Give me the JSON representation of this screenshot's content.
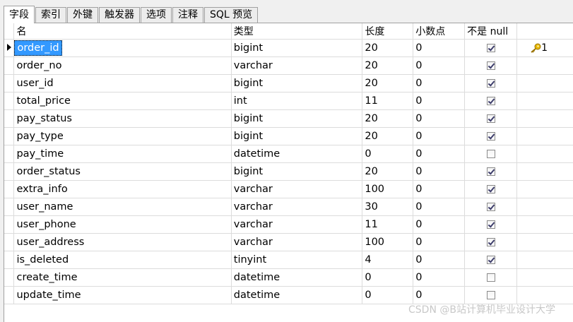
{
  "tabs": [
    "字段",
    "索引",
    "外键",
    "触发器",
    "选项",
    "注释",
    "SQL 预览"
  ],
  "columns": {
    "name": "名",
    "type": "类型",
    "length": "长度",
    "decimals": "小数点",
    "not_null": "不是 null",
    "key": ""
  },
  "rows": [
    {
      "name": "order_id",
      "type": "bigint",
      "length": "20",
      "decimals": "0",
      "not_null": true,
      "key": "1",
      "selected": true
    },
    {
      "name": "order_no",
      "type": "varchar",
      "length": "20",
      "decimals": "0",
      "not_null": true,
      "key": ""
    },
    {
      "name": "user_id",
      "type": "bigint",
      "length": "20",
      "decimals": "0",
      "not_null": true,
      "key": ""
    },
    {
      "name": "total_price",
      "type": "int",
      "length": "11",
      "decimals": "0",
      "not_null": true,
      "key": ""
    },
    {
      "name": "pay_status",
      "type": "bigint",
      "length": "20",
      "decimals": "0",
      "not_null": true,
      "key": ""
    },
    {
      "name": "pay_type",
      "type": "bigint",
      "length": "20",
      "decimals": "0",
      "not_null": true,
      "key": ""
    },
    {
      "name": "pay_time",
      "type": "datetime",
      "length": "0",
      "decimals": "0",
      "not_null": false,
      "key": ""
    },
    {
      "name": "order_status",
      "type": "bigint",
      "length": "20",
      "decimals": "0",
      "not_null": true,
      "key": ""
    },
    {
      "name": "extra_info",
      "type": "varchar",
      "length": "100",
      "decimals": "0",
      "not_null": true,
      "key": ""
    },
    {
      "name": "user_name",
      "type": "varchar",
      "length": "30",
      "decimals": "0",
      "not_null": true,
      "key": ""
    },
    {
      "name": "user_phone",
      "type": "varchar",
      "length": "11",
      "decimals": "0",
      "not_null": true,
      "key": ""
    },
    {
      "name": "user_address",
      "type": "varchar",
      "length": "100",
      "decimals": "0",
      "not_null": true,
      "key": ""
    },
    {
      "name": "is_deleted",
      "type": "tinyint",
      "length": "4",
      "decimals": "0",
      "not_null": true,
      "key": ""
    },
    {
      "name": "create_time",
      "type": "datetime",
      "length": "0",
      "decimals": "0",
      "not_null": false,
      "key": ""
    },
    {
      "name": "update_time",
      "type": "datetime",
      "length": "0",
      "decimals": "0",
      "not_null": false,
      "key": ""
    }
  ],
  "watermark": "CSDN @B站计算机毕业设计大学",
  "icons": {
    "row_indicator": "current-row-arrow-icon",
    "key": "primary-key-icon"
  },
  "colors": {
    "selection": "#3399ff",
    "key_gold": "#e0b000"
  }
}
